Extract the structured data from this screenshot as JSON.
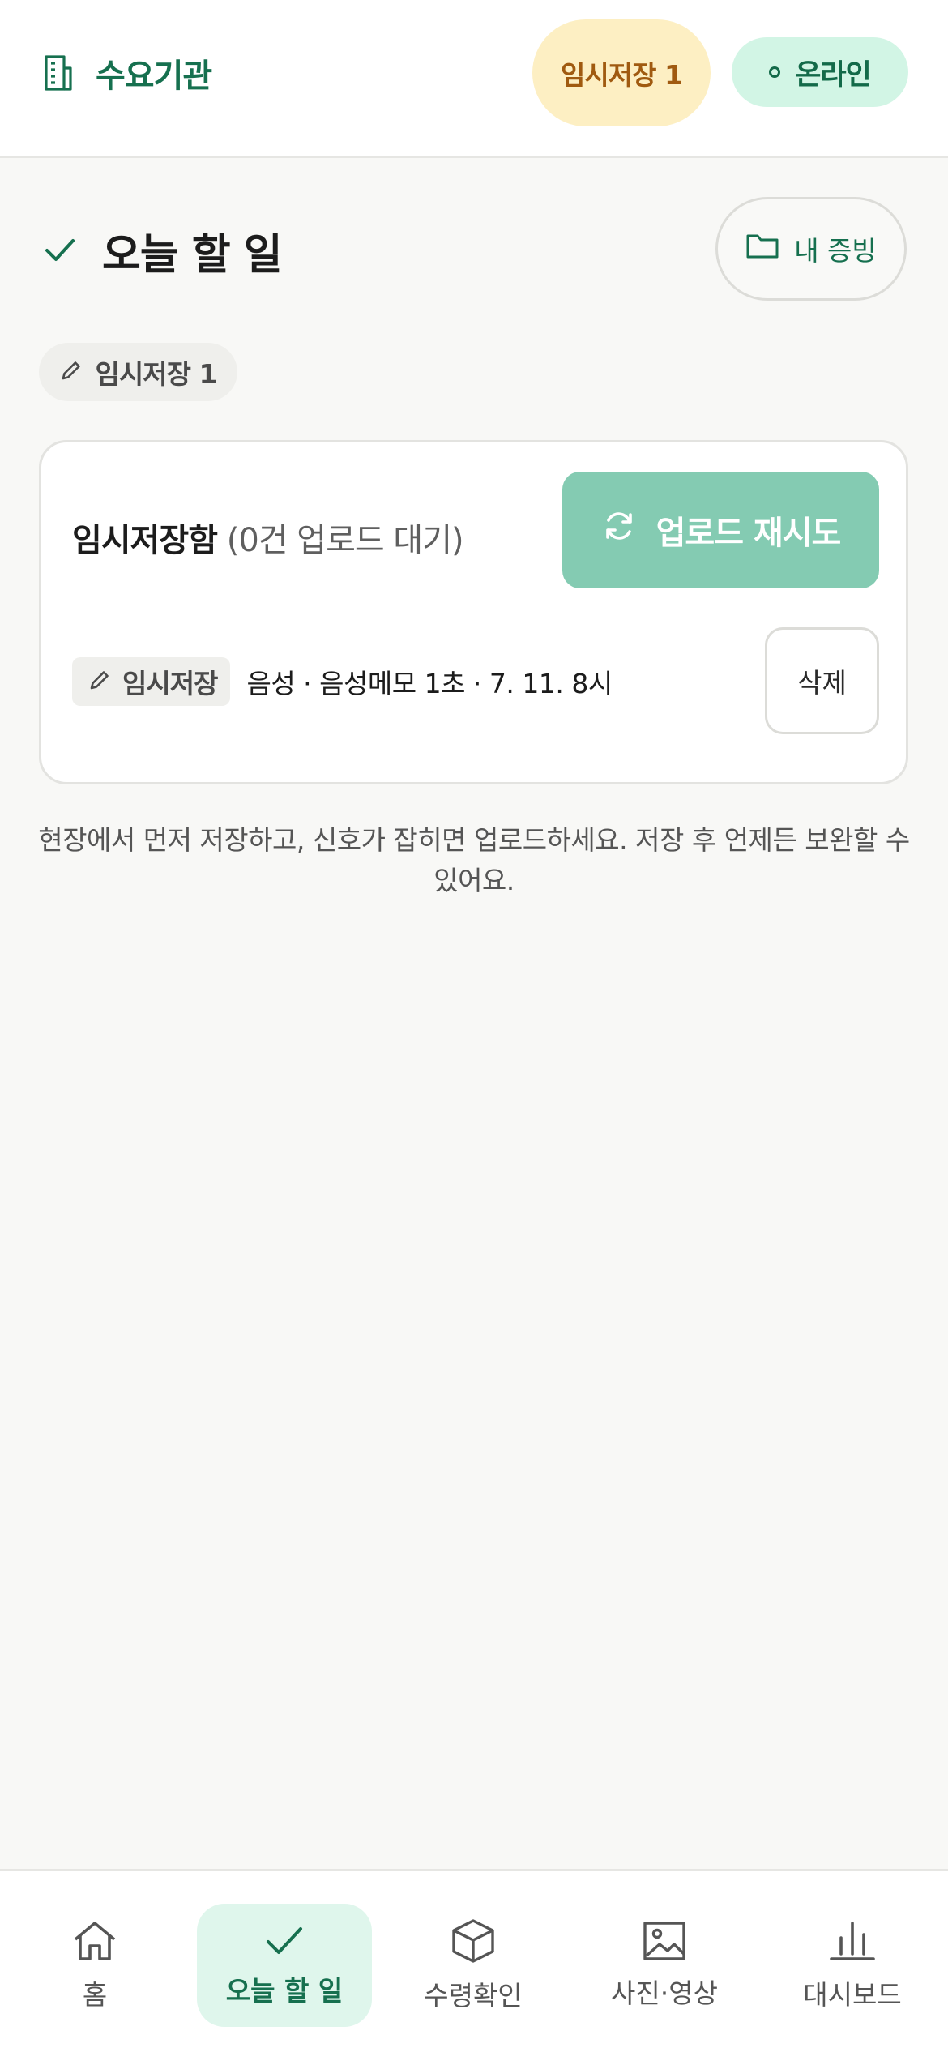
{
  "header": {
    "title": "수요기관",
    "draft_pill": "임시저장 1",
    "status_pill": "온라인"
  },
  "page": {
    "title": "오늘 할 일",
    "evidence_button": "내 증빙",
    "draft_chip": "임시저장 1"
  },
  "outbox": {
    "title": "임시저장함",
    "subtitle": "(0건 업로드 대기)",
    "retry_button": "업로드 재시도",
    "item": {
      "badge": "임시저장",
      "description": "음성 · 음성메모 1초 · 7. 11. 8시",
      "delete_button": "삭제"
    }
  },
  "hint": "현장에서 먼저 저장하고, 신호가 잡히면 업로드하세요. 저장 후 언제든 보완할 수 있어요.",
  "nav": {
    "items": [
      {
        "label": "홈",
        "icon": "home-icon"
      },
      {
        "label": "오늘 할 일",
        "icon": "check-icon"
      },
      {
        "label": "수령확인",
        "icon": "box-icon"
      },
      {
        "label": "사진·영상",
        "icon": "image-icon"
      },
      {
        "label": "대시보드",
        "icon": "bar-chart-icon"
      }
    ],
    "active_index": 1
  },
  "colors": {
    "brand": "#16704f",
    "draft_bg": "#fdefc3",
    "draft_text": "#a05a10",
    "online_bg": "#d2f5e5",
    "retry_bg": "#84cbb2",
    "page_bg": "#f8f8f6"
  }
}
